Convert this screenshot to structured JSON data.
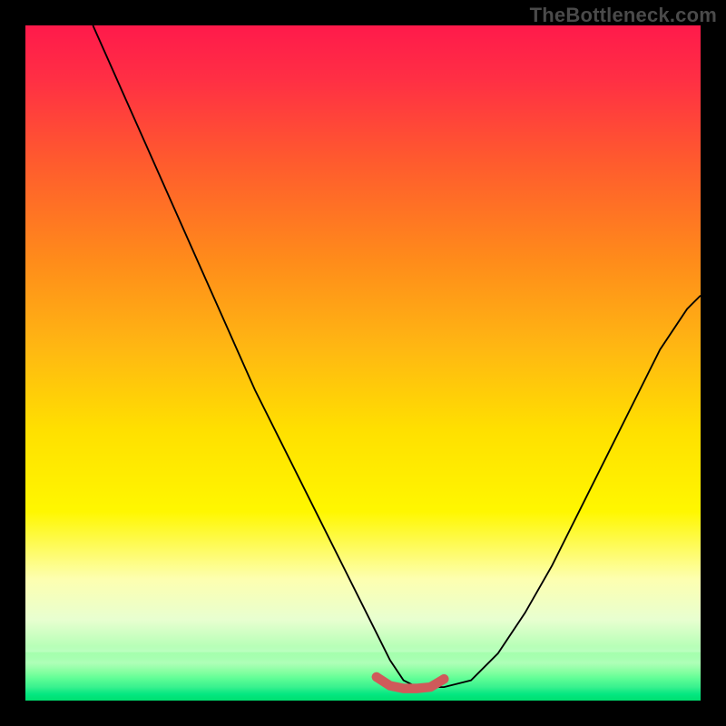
{
  "watermark": "TheBottleneck.com",
  "chart_data": {
    "type": "line",
    "title": "",
    "xlabel": "",
    "ylabel": "",
    "xlim": [
      0,
      100
    ],
    "ylim": [
      0,
      100
    ],
    "grid": false,
    "series": [
      {
        "name": "bottleneck-curve",
        "x": [
          10,
          14,
          18,
          22,
          26,
          30,
          34,
          38,
          42,
          46,
          50,
          52,
          54,
          56,
          58,
          60,
          62,
          66,
          70,
          74,
          78,
          82,
          86,
          90,
          94,
          98,
          100
        ],
        "y": [
          100,
          91,
          82,
          73,
          64,
          55,
          46,
          38,
          30,
          22,
          14,
          10,
          6,
          3,
          2,
          2,
          2,
          3,
          7,
          13,
          20,
          28,
          36,
          44,
          52,
          58,
          60
        ]
      }
    ],
    "highlight_segment": {
      "name": "minimum-band",
      "x": [
        52,
        54,
        56,
        58,
        60,
        62
      ],
      "y": [
        3.5,
        2.2,
        1.8,
        1.8,
        2.0,
        3.2
      ],
      "color": "#cf5a5a"
    },
    "background_gradient": {
      "stops": [
        {
          "pos": 0.0,
          "color": "#ff1a4b"
        },
        {
          "pos": 0.2,
          "color": "#ff5a2e"
        },
        {
          "pos": 0.48,
          "color": "#ffb812"
        },
        {
          "pos": 0.72,
          "color": "#fff700"
        },
        {
          "pos": 0.88,
          "color": "#e8ffd0"
        },
        {
          "pos": 1.0,
          "color": "#00e878"
        }
      ]
    }
  }
}
